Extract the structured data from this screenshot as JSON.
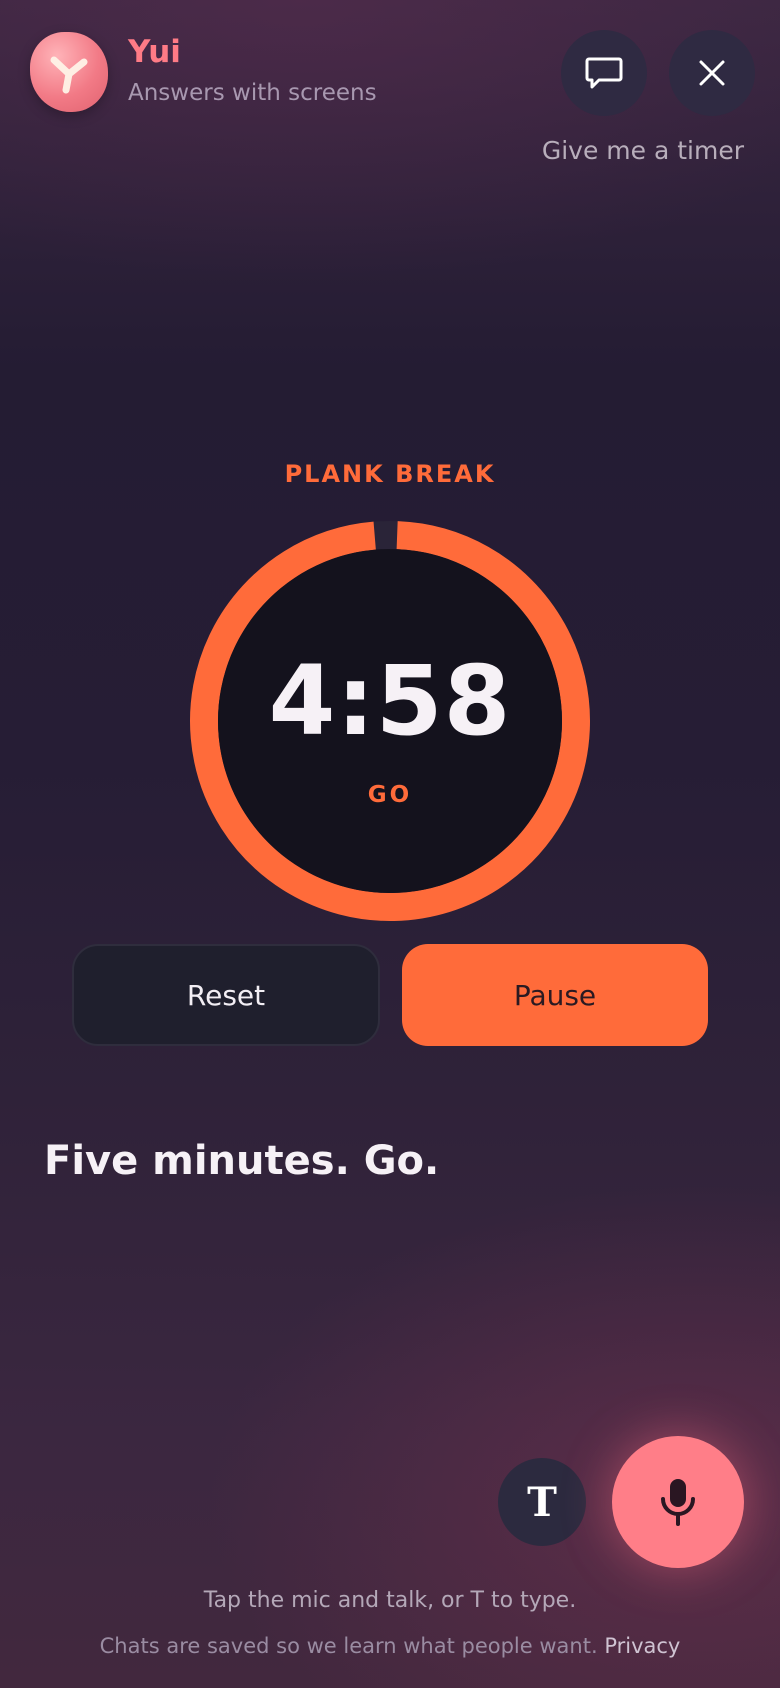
{
  "header": {
    "app_name": "Yui",
    "app_subtitle": "Answers with screens",
    "user_query": "Give me a timer"
  },
  "timer": {
    "label": "PLANK BREAK",
    "time": "4:58",
    "status": "GO",
    "progress_fraction": 0.993,
    "ring_color": "#ff6b3a"
  },
  "controls": {
    "reset_label": "Reset",
    "pause_label": "Pause"
  },
  "response": {
    "caption": "Five minutes. Go."
  },
  "input": {
    "type_label": "T",
    "hint": "Tap the mic and talk, or T to type.",
    "footer_text": "Chats are saved so we learn what people want.",
    "privacy_link": "Privacy"
  },
  "icons": {
    "chat": "chat-bubble-icon",
    "close": "close-icon",
    "mic": "microphone-icon",
    "logo": "yui-logo-icon"
  },
  "colors": {
    "accent": "#ff6b3a",
    "brand": "#ff7b86"
  }
}
